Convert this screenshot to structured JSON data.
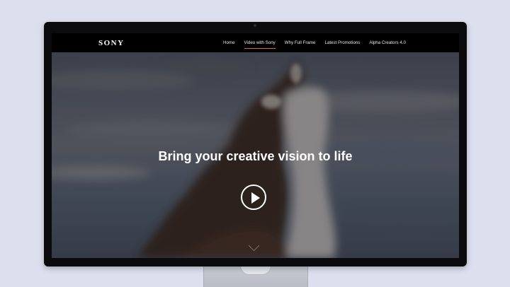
{
  "brand": {
    "logo_text": "SONY"
  },
  "nav": {
    "items": [
      {
        "label": "Home",
        "active": false
      },
      {
        "label": "Video with Sony",
        "active": true
      },
      {
        "label": "Why Full Frame",
        "active": false
      },
      {
        "label": "Latest Promotions",
        "active": false
      },
      {
        "label": "Alpha Creators 4.0",
        "active": false
      }
    ],
    "active_underline_color": "#e0633d"
  },
  "hero": {
    "headline": "Bring your creative vision to life",
    "play_icon": "play-icon",
    "scroll_icon": "chevron-down-icon"
  },
  "colors": {
    "desktop_background": "#dcdfee",
    "nav_background": "#000000",
    "text": "#ffffff"
  }
}
